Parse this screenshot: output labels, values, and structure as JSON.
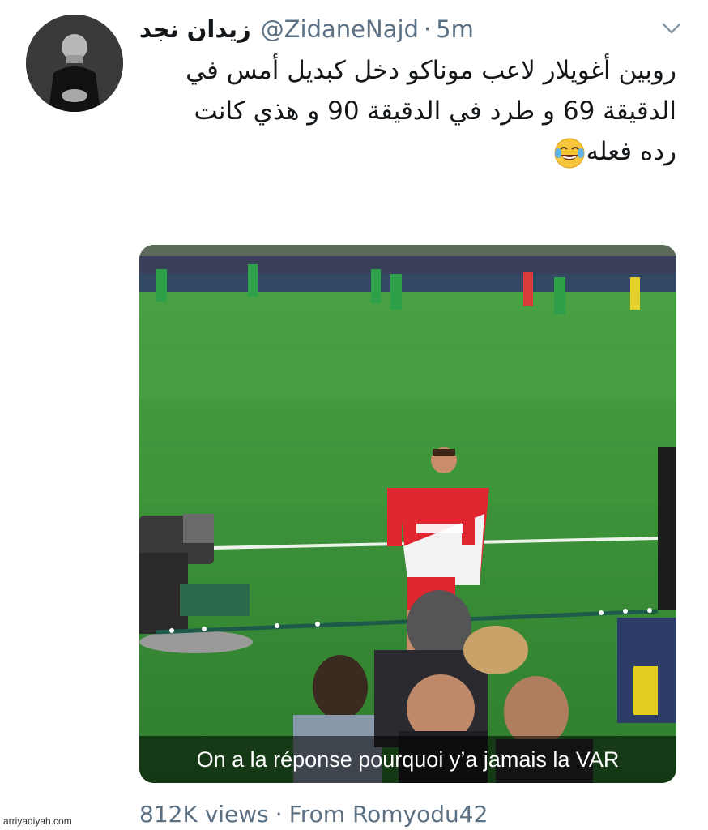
{
  "tweet": {
    "display_name": "زيدان نجد",
    "handle": "@ZidaneNajd",
    "separator": "·",
    "time": "5m",
    "text_lines": [
      "روبين أغويلار لاعب موناكو دخل كبديل أمس في",
      "الدقيقة 69 و طرد في الدقيقة 90 و هذي كانت",
      "رده فعله"
    ],
    "emoji": "face-with-tears-of-joy-icon"
  },
  "media": {
    "subtitle": "On a la réponse pourquoi y’a jamais la VAR"
  },
  "footer": {
    "views": "812K views",
    "separator": "·",
    "source": "From Romyodu42"
  },
  "watermark": "arriyadiyah.com",
  "colors": {
    "text": "#14171a",
    "secondary": "#5b7083",
    "pitch": "#3f9a3c"
  }
}
